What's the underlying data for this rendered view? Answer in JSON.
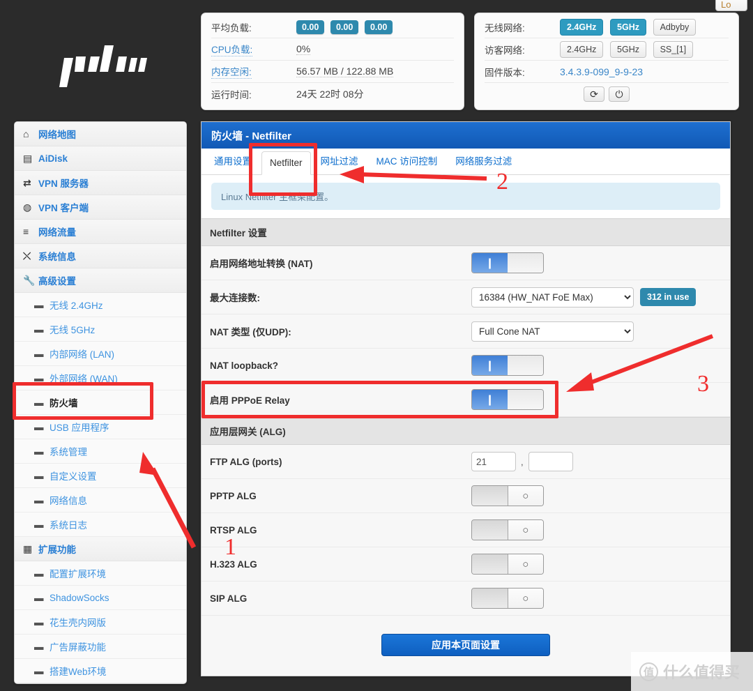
{
  "window": {
    "logout_label": "Lo",
    "logo_alt": "padavan"
  },
  "status_left": {
    "rows": [
      {
        "label": "平均负载:",
        "type": "badges",
        "values": [
          "0.00",
          "0.00",
          "0.00"
        ]
      },
      {
        "label": "CPU负载:",
        "type": "text",
        "value": "0%",
        "link": true
      },
      {
        "label": "内存空闲:",
        "type": "text",
        "value": "56.57 MB / 122.88 MB",
        "link": true
      },
      {
        "label": "运行时间:",
        "type": "text",
        "value": "24天 22时 08分",
        "link": false
      }
    ]
  },
  "status_right": {
    "wireless_label": "无线网络:",
    "wireless_pills": [
      {
        "text": "2.4GHz",
        "on": true
      },
      {
        "text": "5GHz",
        "on": true
      },
      {
        "text": "Adbyby",
        "on": false
      }
    ],
    "guest_label": "访客网络:",
    "guest_pills": [
      {
        "text": "2.4GHz",
        "on": false
      },
      {
        "text": "5GHz",
        "on": false
      },
      {
        "text": "SS_[1]",
        "on": false
      }
    ],
    "firmware_label": "固件版本:",
    "firmware_value": "3.4.3.9-099_9-9-23",
    "reboot_icon": "refresh-icon",
    "power_icon": "power-icon",
    "reboot_glyph": "⟳",
    "power_glyph": "⏻"
  },
  "sidebar": {
    "items": [
      {
        "label": "网络地图",
        "icon": "home-icon",
        "glyph": "⌂",
        "type": "top"
      },
      {
        "label": "AiDisk",
        "icon": "disk-icon",
        "glyph": "▤",
        "type": "top"
      },
      {
        "label": "VPN 服务器",
        "icon": "vpn-icon",
        "glyph": "⇄",
        "type": "top"
      },
      {
        "label": "VPN 客户端",
        "icon": "globe-icon",
        "glyph": "◍",
        "type": "top"
      },
      {
        "label": "网络流量",
        "icon": "traffic-icon",
        "glyph": "≡",
        "type": "top"
      },
      {
        "label": "系统信息",
        "icon": "shuffle-icon",
        "glyph": "⤬",
        "type": "top"
      },
      {
        "label": "高级设置",
        "icon": "wrench-icon",
        "glyph": "🔧",
        "type": "top"
      },
      {
        "label": "无线 2.4GHz",
        "type": "sub"
      },
      {
        "label": "无线 5GHz",
        "type": "sub"
      },
      {
        "label": "内部网络 (LAN)",
        "type": "sub"
      },
      {
        "label": "外部网络 (WAN)",
        "type": "sub"
      },
      {
        "label": "防火墙",
        "type": "sub",
        "active": true
      },
      {
        "label": "USB 应用程序",
        "type": "sub"
      },
      {
        "label": "系统管理",
        "type": "sub"
      },
      {
        "label": "自定义设置",
        "type": "sub"
      },
      {
        "label": "网络信息",
        "type": "sub"
      },
      {
        "label": "系统日志",
        "type": "sub"
      },
      {
        "label": "扩展功能",
        "icon": "grid-icon",
        "glyph": "▦",
        "type": "top"
      },
      {
        "label": "配置扩展环境",
        "type": "sub"
      },
      {
        "label": "ShadowSocks",
        "type": "sub"
      },
      {
        "label": "花生壳内网版",
        "type": "sub"
      },
      {
        "label": "广告屏蔽功能",
        "type": "sub"
      },
      {
        "label": "搭建Web环境",
        "type": "sub"
      }
    ]
  },
  "main": {
    "title": "防火墙 - Netfilter",
    "tabs": [
      {
        "label": "通用设置",
        "active": false
      },
      {
        "label": "Netfilter",
        "active": true
      },
      {
        "label": "网址过滤",
        "active": false
      },
      {
        "label": "MAC 访问控制",
        "active": false
      },
      {
        "label": "网络服务过滤",
        "active": false
      }
    ],
    "info": "Linux Netfilter 主框架配置。",
    "section_netfilter": "Netfilter 设置",
    "section_alg": "应用层网关 (ALG)",
    "rows": [
      {
        "label": "启用网络地址转换 (NAT)",
        "control": "toggle",
        "state": "on"
      },
      {
        "label": "最大连接数:",
        "control": "select",
        "value": "16384 (HW_NAT FoE Max)",
        "badge": "312 in use"
      },
      {
        "label": "NAT 类型 (仅UDP):",
        "control": "select",
        "value": "Full Cone NAT"
      },
      {
        "label": "NAT loopback?",
        "control": "toggle",
        "state": "on"
      },
      {
        "label": "启用 PPPoE Relay",
        "control": "toggle",
        "state": "on"
      }
    ],
    "alg_rows": [
      {
        "label": "FTP ALG (ports)",
        "control": "ports",
        "value1": "21",
        "value2": ""
      },
      {
        "label": "PPTP ALG",
        "control": "toggle",
        "state": "off"
      },
      {
        "label": "RTSP ALG",
        "control": "toggle",
        "state": "off"
      },
      {
        "label": "H.323 ALG",
        "control": "toggle",
        "state": "off"
      },
      {
        "label": "SIP ALG",
        "control": "toggle",
        "state": "off"
      }
    ],
    "toggle_on_glyph": "❙",
    "toggle_off_glyph": "○",
    "apply_label": "应用本页面设置"
  },
  "annotations": {
    "num1": "1",
    "num2": "2",
    "num3": "3",
    "highlight_color": "#ef2d2d"
  },
  "watermark": {
    "mark": "值",
    "text": "什么值得买"
  }
}
